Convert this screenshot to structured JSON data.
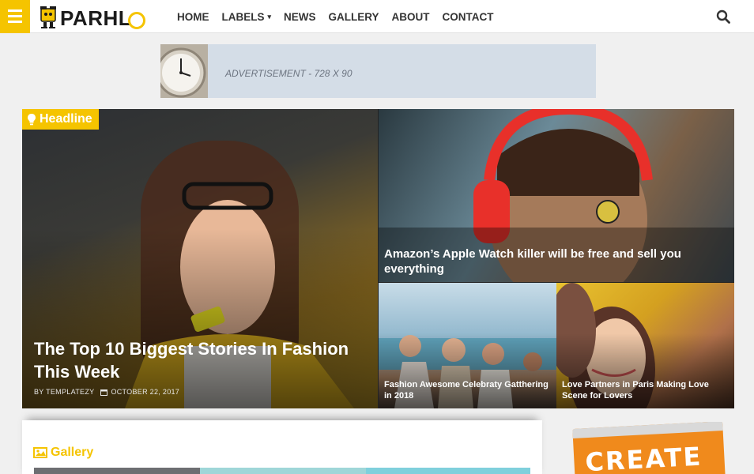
{
  "header": {
    "logo_text": "PARHL",
    "nav": [
      {
        "label": "HOME"
      },
      {
        "label": "LABELS"
      },
      {
        "label": "NEWS"
      },
      {
        "label": "GALLERY"
      },
      {
        "label": "ABOUT"
      },
      {
        "label": "CONTACT"
      }
    ]
  },
  "ad": {
    "label": "ADVERTISEMENT - 728 X 90"
  },
  "featured": {
    "badge": "Headline",
    "main": {
      "title": "The Top 10 Biggest Stories In Fashion This Week",
      "author": "BY TEMPLATEZY",
      "date": "OCTOBER 22, 2017"
    },
    "top_right": {
      "title": "Amazon’s Apple Watch killer will be free and sell you everything"
    },
    "bottom_left": {
      "title": "Fashion Awesome Celebraty Gatthering in 2018"
    },
    "bottom_right": {
      "title": "Love Partners in Paris Making Love Scene for Lovers"
    }
  },
  "gallery": {
    "title": "Gallery"
  },
  "side_ad": {
    "text": "CREATE"
  },
  "colors": {
    "accent": "#f5c400",
    "nav_text": "#333333"
  },
  "icons": [
    "menu-icon",
    "search-icon",
    "lightbulb-icon",
    "calendar-icon",
    "image-icon",
    "caret-down-icon"
  ]
}
